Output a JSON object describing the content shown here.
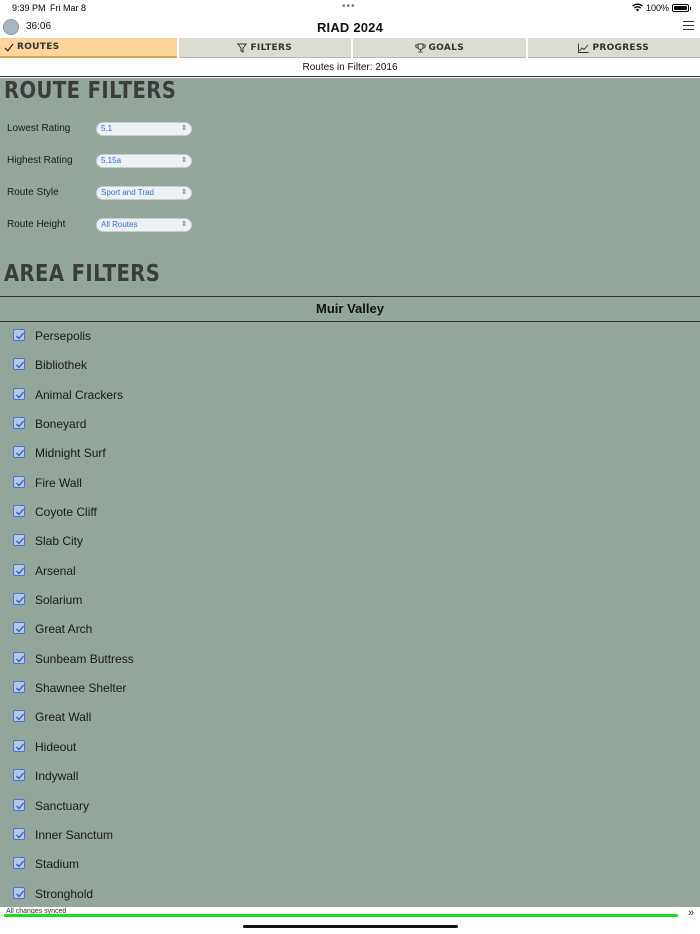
{
  "status_bar": {
    "time": "9:39 PM",
    "date": "Fri Mar 8",
    "battery": "100%"
  },
  "header": {
    "timer": "36:06",
    "title": "RIAD 2024"
  },
  "tabs": [
    {
      "label": "ROUTES",
      "icon": "checkmark-icon",
      "active": true
    },
    {
      "label": "FILTERS",
      "icon": "funnel-icon",
      "active": false
    },
    {
      "label": "GOALS",
      "icon": "trophy-icon",
      "active": false
    },
    {
      "label": "PROGRESS",
      "icon": "line-chart-icon",
      "active": false
    }
  ],
  "routes_count": "Routes in Filter: 2016",
  "route_filters": {
    "title": "ROUTE FILTERS",
    "rows": [
      {
        "label": "Lowest Rating",
        "value": "5.1"
      },
      {
        "label": "Highest Rating",
        "value": "5.15a"
      },
      {
        "label": "Route Style",
        "value": "Sport and Trad"
      },
      {
        "label": "Route Height",
        "value": "All Routes"
      }
    ]
  },
  "area_filters": {
    "title": "AREA FILTERS",
    "region": "Muir Valley",
    "areas": [
      "Persepolis",
      "Bibliothek",
      "Animal Crackers",
      "Boneyard",
      "Midnight Surf",
      "Fire Wall",
      "Coyote Cliff",
      "Slab City",
      "Arsenal",
      "Solarium",
      "Great Arch",
      "Sunbeam Buttress",
      "Shawnee Shelter",
      "Great Wall",
      "Hideout",
      "Indywall",
      "Sanctuary",
      "Inner Sanctum",
      "Stadium",
      "Stronghold"
    ]
  },
  "footer": {
    "sync_status": "All changes synced",
    "progress": 1.0
  },
  "colors": {
    "tab_active": "#fdd59a",
    "content_bg": "#94a59b",
    "checkbox": "#4b76d0",
    "sync_bar": "#16e01b"
  }
}
